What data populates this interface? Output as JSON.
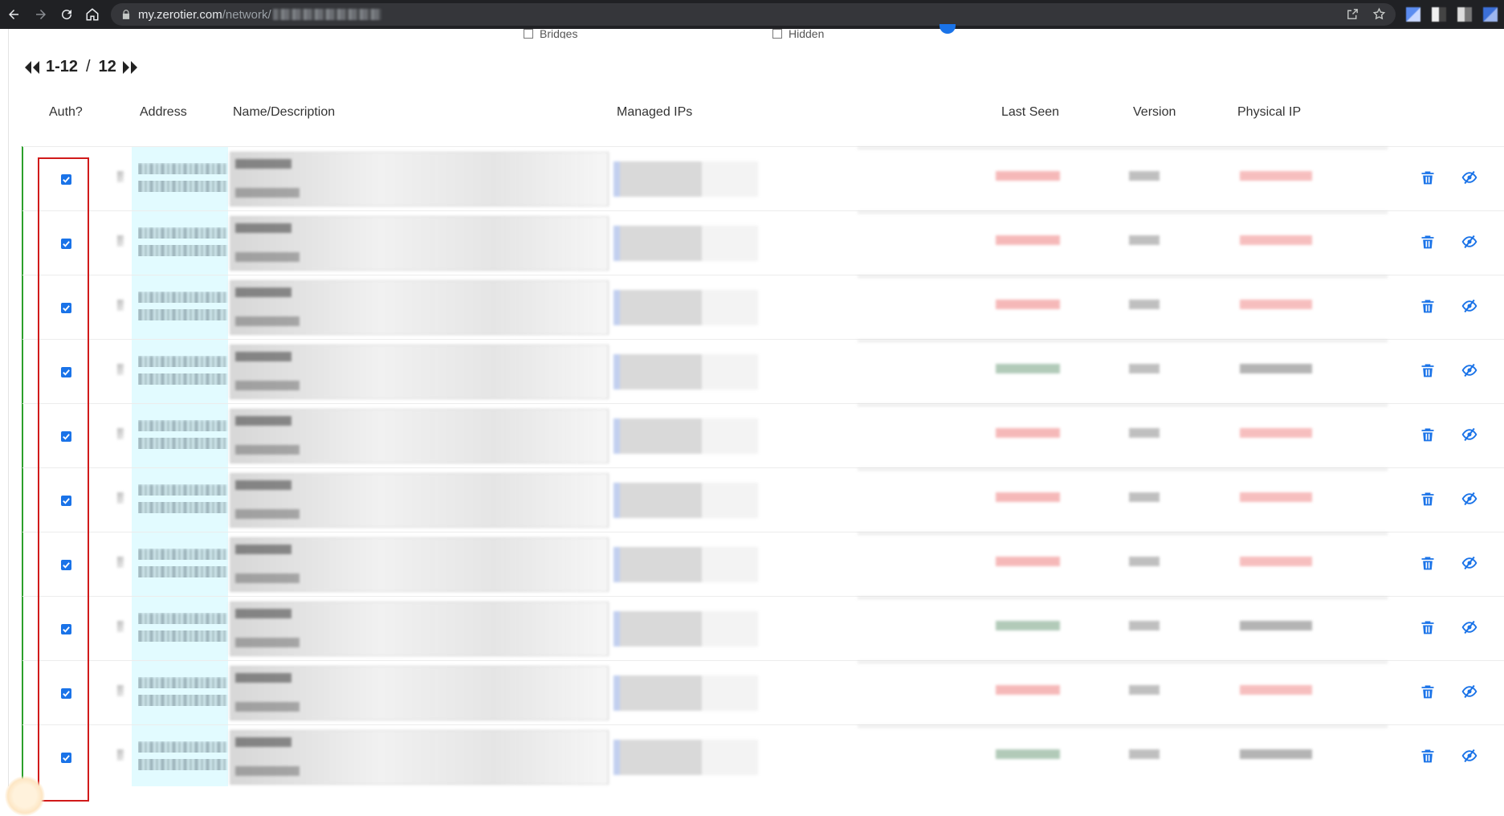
{
  "browser": {
    "url_host": "my.zerotier.com",
    "url_path": "/network/"
  },
  "top_filters": {
    "bridges_label": "Bridges",
    "hidden_label": "Hidden"
  },
  "pager": {
    "range": "1-12",
    "separator": "/",
    "total": "12"
  },
  "columns": {
    "auth": "Auth?",
    "address": "Address",
    "name": "Name/Description",
    "managed_ips": "Managed IPs",
    "last_seen": "Last Seen",
    "version": "Version",
    "physical_ip": "Physical IP"
  },
  "rows": [
    {
      "authorized": true,
      "last_seen_tone": "red"
    },
    {
      "authorized": true,
      "last_seen_tone": "red"
    },
    {
      "authorized": true,
      "last_seen_tone": "red"
    },
    {
      "authorized": true,
      "last_seen_tone": "green"
    },
    {
      "authorized": true,
      "last_seen_tone": "red"
    },
    {
      "authorized": true,
      "last_seen_tone": "red"
    },
    {
      "authorized": true,
      "last_seen_tone": "red"
    },
    {
      "authorized": true,
      "last_seen_tone": "green"
    },
    {
      "authorized": true,
      "last_seen_tone": "red"
    },
    {
      "authorized": true,
      "last_seen_tone": "green"
    }
  ],
  "colors": {
    "accent": "#1a73e8",
    "highlight_border": "#d11a1a",
    "online_line": "#2ca02c",
    "address_band": "#e2fbff",
    "offline_text": "#f08a8a",
    "online_text": "#7fa88a"
  },
  "icons": {
    "back": "arrow-left-icon",
    "forward": "arrow-right-icon",
    "reload": "reload-icon",
    "home": "home-icon",
    "lock": "lock-icon",
    "share": "share-icon",
    "star": "star-icon",
    "first_page": "double-chevron-left-icon",
    "last_page": "double-chevron-right-icon",
    "delete": "trash-icon",
    "hide": "eye-slash-icon"
  }
}
